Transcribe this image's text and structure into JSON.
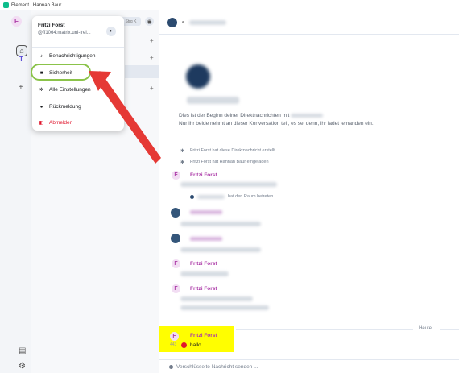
{
  "window": {
    "title": "Element | Hannah Baur"
  },
  "spaces": {
    "user_initial": "F",
    "space_initial": "T",
    "add_label": "+"
  },
  "roomlist": {
    "search_hint": "Strg K",
    "plus_label": "+"
  },
  "user_menu": {
    "display_name": "Fritzi Forst",
    "user_id": "@ff1064:matrix.uni-frei...",
    "items": [
      {
        "label": "Benachrichtigungen",
        "icon": "bell-icon"
      },
      {
        "label": "Sicherheit",
        "icon": "lock-icon"
      },
      {
        "label": "Alle Einstellungen",
        "icon": "gear-icon"
      },
      {
        "label": "Rückmeldung",
        "icon": "feedback-icon"
      },
      {
        "label": "Abmelden",
        "icon": "signout-icon"
      }
    ]
  },
  "timeline": {
    "intro_line_1": "Dies ist der Beginn deiner Direktnachrichten mit",
    "intro_line_2": "Nur ihr beide nehmt an dieser Konversation teil, es sei denn, ihr ladet jemanden ein.",
    "event_1": "Fritzi Forst hat diese Direktnachricht erstellt.",
    "event_2": "Fritzi Forst hat Hannah Baur eingeladen",
    "sender_name": "Fritzi Forst",
    "joined_text": "hat den Raum betreten",
    "day_separator": "Heute",
    "last_message": {
      "sender": "Fritzi Forst",
      "time": "443",
      "text": "hallo"
    },
    "composer_placeholder": "Verschlüsselte Nachricht senden ..."
  },
  "annotation": {
    "highlight_color": "#fffe00",
    "ring_color": "#8bc34a",
    "arrow_color": "#e53935"
  }
}
